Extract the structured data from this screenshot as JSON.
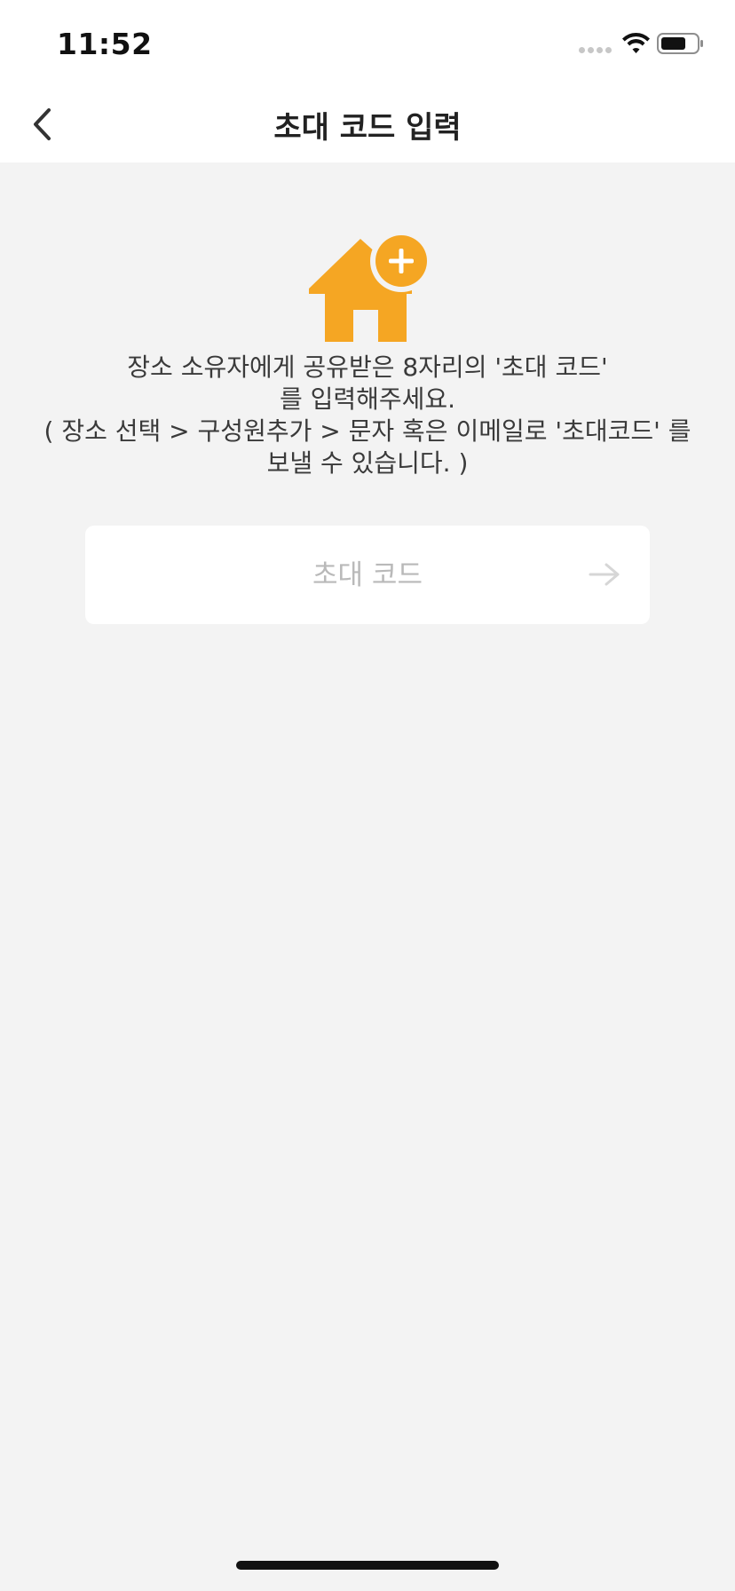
{
  "status_bar": {
    "time": "11:52",
    "icons": [
      "signal-dots-icon",
      "wifi-icon",
      "battery-icon"
    ]
  },
  "nav": {
    "back_icon": "chevron-left-icon",
    "title": "초대 코드 입력"
  },
  "main": {
    "icon": "house-plus-icon",
    "description_lines": [
      "장소 소유자에게 공유받은 8자리의 '초대 코드'",
      "를 입력해주세요.",
      "( 장소 선택 > 구성원추가 > 문자 혹은 이메일로 '초대코드' 를",
      "보낼 수 있습니다. )"
    ],
    "code_input": {
      "value": "",
      "placeholder": "초대 코드"
    },
    "submit_icon": "arrow-right-icon"
  },
  "colors": {
    "accent": "#F5A623",
    "background": "#F3F3F3",
    "header": "#FFFFFF",
    "placeholder": "#B9B9B9"
  }
}
